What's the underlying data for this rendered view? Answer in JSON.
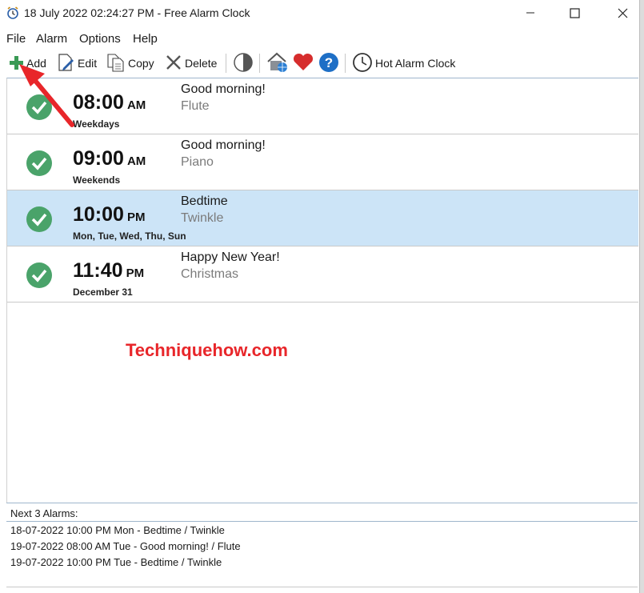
{
  "window": {
    "title": "18 July 2022 02:24:27 PM - Free Alarm Clock"
  },
  "menu": [
    "File",
    "Alarm",
    "Options",
    "Help"
  ],
  "toolbar": {
    "add": "Add",
    "edit": "Edit",
    "copy": "Copy",
    "delete": "Delete",
    "hot": "Hot Alarm Clock"
  },
  "alarms": [
    {
      "time": "08:00",
      "ampm": "AM",
      "days": "Weekdays",
      "name": "Good morning!",
      "sound": "Flute",
      "selected": false
    },
    {
      "time": "09:00",
      "ampm": "AM",
      "days": "Weekends",
      "name": "Good morning!",
      "sound": "Piano",
      "selected": false
    },
    {
      "time": "10:00",
      "ampm": "PM",
      "days": "Mon, Tue, Wed, Thu, Sun",
      "name": "Bedtime",
      "sound": "Twinkle",
      "selected": true
    },
    {
      "time": "11:40",
      "ampm": "PM",
      "days": "December 31",
      "name": "Happy New Year!",
      "sound": "Christmas",
      "selected": false
    }
  ],
  "watermark": "Techniquehow.com",
  "next": {
    "title": "Next 3 Alarms:",
    "items": [
      "18-07-2022 10:00 PM Mon - Bedtime / Twinkle",
      "19-07-2022 08:00 AM Tue - Good morning! / Flute",
      "19-07-2022 10:00 PM Tue - Bedtime / Twinkle"
    ]
  },
  "colors": {
    "check_green": "#4aa36a",
    "selection": "#cce4f7",
    "annotation_red": "#e8262a"
  }
}
